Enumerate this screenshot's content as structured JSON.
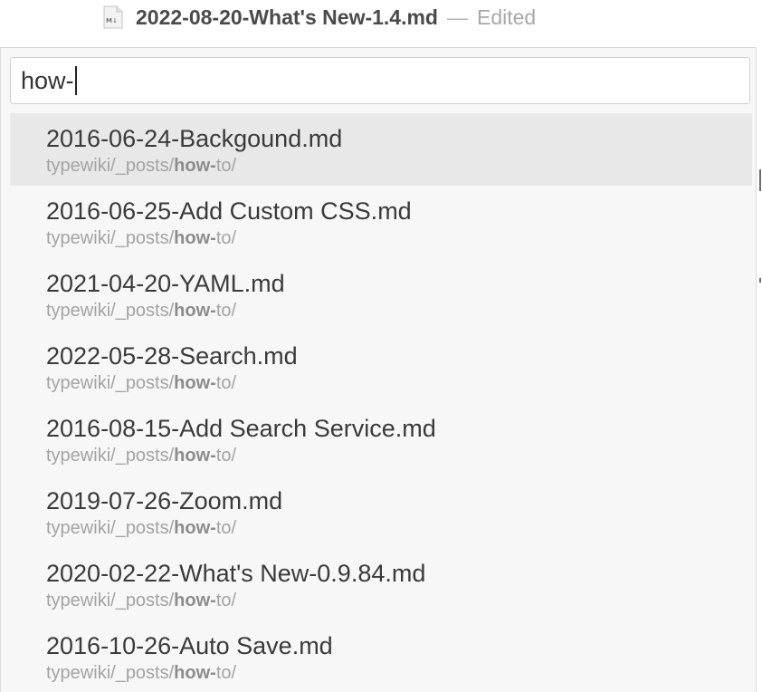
{
  "window": {
    "title": "2022-08-20-What's New-1.4.md",
    "separator": "—",
    "status": "Edited",
    "doc_icon": "markdown-file-icon"
  },
  "search": {
    "value": "how-"
  },
  "results": [
    {
      "name": "2016-06-24-Backgound.md",
      "path_prefix": "typewiki/_posts/",
      "path_match": "how-",
      "path_suffix": "to/",
      "selected": true
    },
    {
      "name": "2016-06-25-Add Custom CSS.md",
      "path_prefix": "typewiki/_posts/",
      "path_match": "how-",
      "path_suffix": "to/",
      "selected": false
    },
    {
      "name": "2021-04-20-YAML.md",
      "path_prefix": "typewiki/_posts/",
      "path_match": "how-",
      "path_suffix": "to/",
      "selected": false
    },
    {
      "name": "2022-05-28-Search.md",
      "path_prefix": "typewiki/_posts/",
      "path_match": "how-",
      "path_suffix": "to/",
      "selected": false
    },
    {
      "name": "2016-08-15-Add Search Service.md",
      "path_prefix": "typewiki/_posts/",
      "path_match": "how-",
      "path_suffix": "to/",
      "selected": false
    },
    {
      "name": "2019-07-26-Zoom.md",
      "path_prefix": "typewiki/_posts/",
      "path_match": "how-",
      "path_suffix": "to/",
      "selected": false
    },
    {
      "name": "2020-02-22-What's New-0.9.84.md",
      "path_prefix": "typewiki/_posts/",
      "path_match": "how-",
      "path_suffix": "to/",
      "selected": false
    },
    {
      "name": "2016-10-26-Auto Save.md",
      "path_prefix": "typewiki/_posts/",
      "path_match": "how-",
      "path_suffix": "to/",
      "selected": false
    }
  ]
}
